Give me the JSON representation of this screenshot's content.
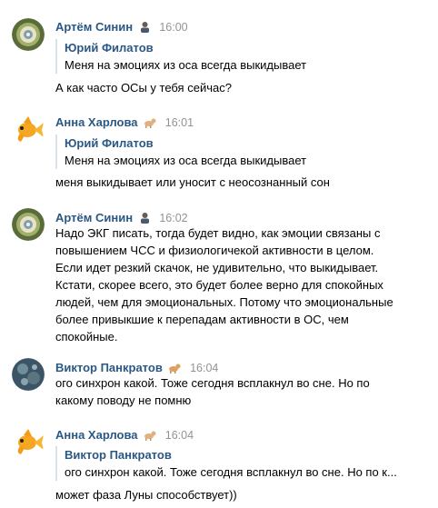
{
  "messages": [
    {
      "author": "Артём Синин",
      "author_emoji": "person-emoji",
      "time": "16:00",
      "avatar": "pattern-avatar",
      "quote": {
        "author": "Юрий Филатов",
        "text": "Меня на эмоциях из оса всегда выкидывает"
      },
      "lines": [
        "А как часто ОСы у тебя сейчас?"
      ]
    },
    {
      "author": "Анна Харлова",
      "author_emoji": "dog-emoji",
      "time": "16:01",
      "avatar": "goldfish-avatar",
      "quote": {
        "author": "Юрий Филатов",
        "text": "Меня на эмоциях из оса всегда выкидывает"
      },
      "lines": [
        "меня выкидывает или уносит с неосознанный сон"
      ]
    },
    {
      "author": "Артём Синин",
      "author_emoji": "person-emoji",
      "time": "16:02",
      "avatar": "pattern-avatar",
      "lines": [
        "Надо ЭКГ писать, тогда будет видно, как эмоции связаны с",
        "повышением ЧСС и физиологичекой активности в целом.",
        "Если идет резкий скачок, не удивительно, что выкидывает.",
        "Кстати, скорее всего, это будет более верно для спокойных",
        "людей, чем для эмоциональных. Потому что эмоциональные",
        "более привыкшие к перепадам активности в ОС, чем",
        "спокойные."
      ]
    },
    {
      "author": "Виктор Панкратов",
      "author_emoji": "dog-emoji",
      "time": "16:04",
      "avatar": "blue-pattern-avatar",
      "lines": [
        "ого синхрон какой. Тоже сегодня всплакнул во сне. Но по",
        "какому поводу не помню"
      ]
    },
    {
      "author": "Анна Харлова",
      "author_emoji": "dog-emoji",
      "time": "16:04",
      "avatar": "goldfish-avatar",
      "quote": {
        "author": "Виктор Панкратов",
        "text": "ого синхрон какой. Тоже сегодня всплакнул во сне. Но по к..."
      },
      "lines": [
        "может фаза Луны способствует))"
      ]
    }
  ],
  "colors": {
    "author": "#2a5885",
    "time": "#939393",
    "quote_bar": "#dae1e8"
  }
}
